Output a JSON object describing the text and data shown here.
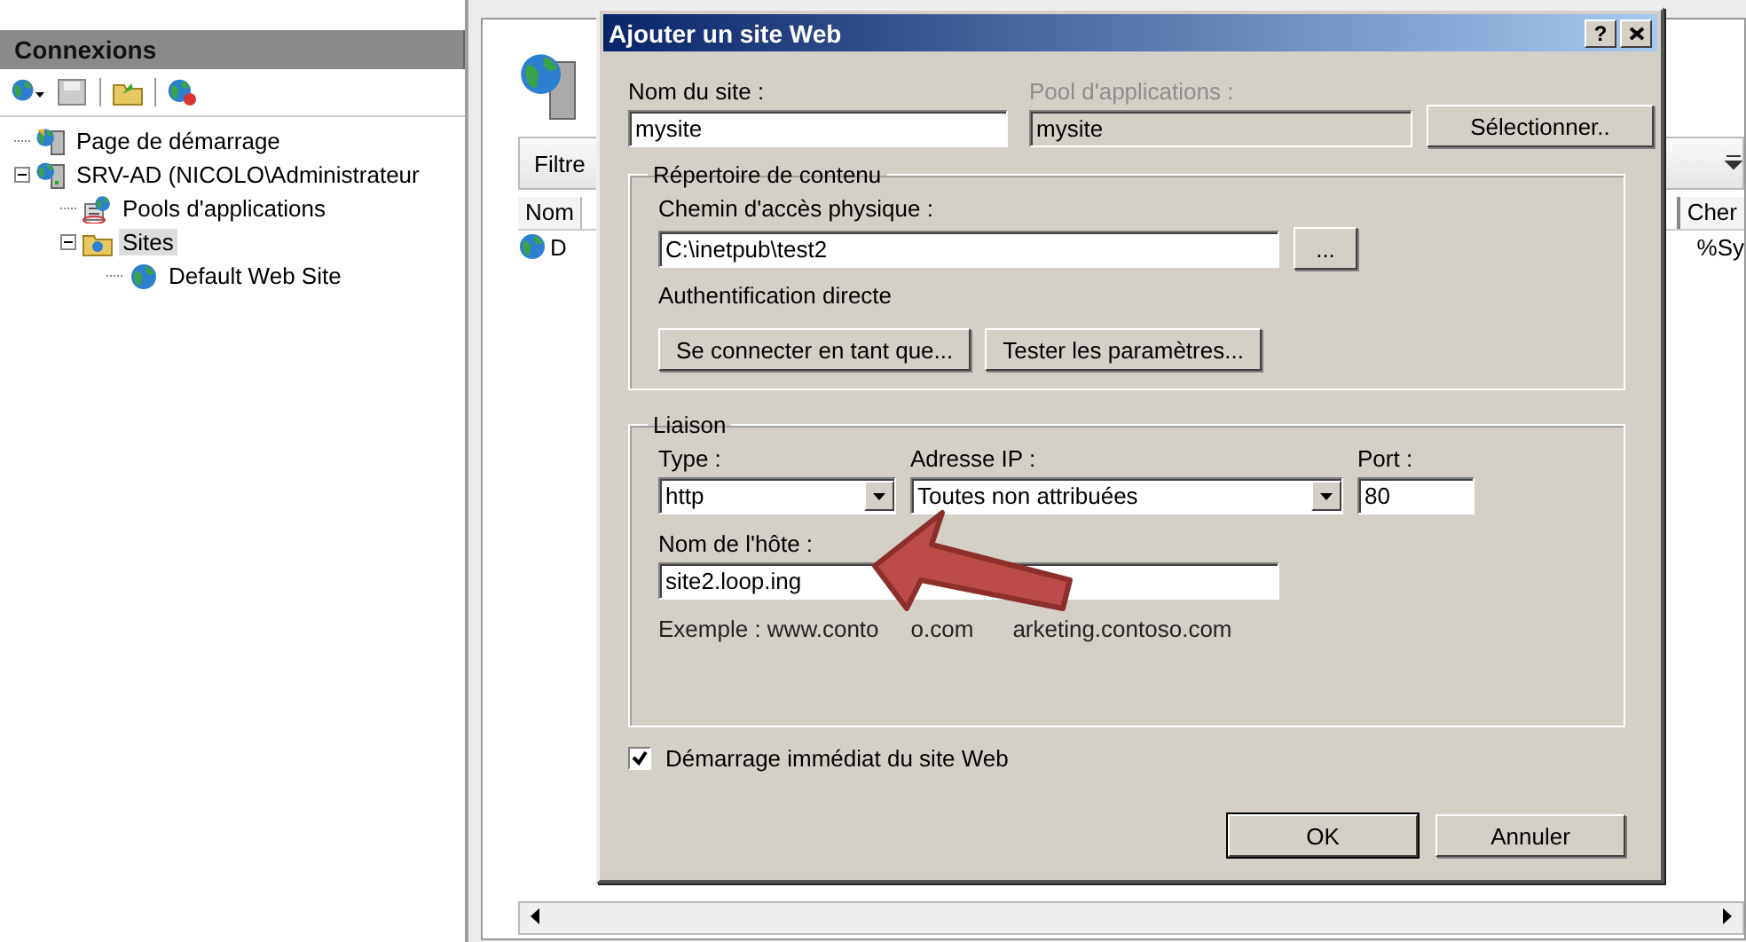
{
  "connections": {
    "title": "Connexions",
    "tree": [
      {
        "label": "Page de démarrage",
        "kind": "start",
        "selected": false
      },
      {
        "label": "SRV-AD (NICOLO\\Administrateur",
        "kind": "server",
        "selected": false,
        "expanded": true,
        "children": [
          {
            "label": "Pools d'applications",
            "kind": "pools",
            "selected": false
          },
          {
            "label": "Sites",
            "kind": "folder",
            "selected": true,
            "expanded": true,
            "children": [
              {
                "label": "Default Web Site",
                "kind": "site",
                "selected": false
              }
            ]
          }
        ]
      }
    ]
  },
  "sites_panel": {
    "toolbar_label": "Filtre",
    "columns": [
      "Nom",
      "Cher"
    ],
    "rows": [
      {
        "cells": [
          "D",
          "%Sy"
        ]
      }
    ]
  },
  "dialog": {
    "title": "Ajouter un site Web",
    "help_button": "?",
    "site_name": {
      "label": "Nom du site :",
      "value": "mysite"
    },
    "app_pool": {
      "label": "Pool d'applications :",
      "value": "mysite",
      "disabled": true
    },
    "select_button": "Sélectionner..",
    "content": {
      "title": "Répertoire de contenu",
      "path_label": "Chemin d'accès physique :",
      "path_value": "C:\\inetpub\\test2",
      "browse_button": "...",
      "auth_label": "Authentification directe",
      "buttons": [
        "Se connecter en tant que...",
        "Tester les paramètres..."
      ]
    },
    "binding": {
      "title": "Liaison",
      "type": {
        "label": "Type :",
        "value": "http"
      },
      "ip": {
        "label": "Adresse IP :",
        "value": "Toutes non attribuées"
      },
      "port": {
        "label": "Port :",
        "value": "80"
      },
      "host": {
        "label": "Nom de l'hôte :",
        "value": "site2.loop.ing"
      },
      "example": [
        "Exemple : www.conto",
        "o.com",
        "arketing.contoso.com"
      ]
    },
    "start_checkbox": {
      "label": "Démarrage immédiat du site Web",
      "checked": true
    },
    "buttons": [
      {
        "label": "OK",
        "default": true
      },
      {
        "label": "Annuler",
        "default": false
      }
    ]
  }
}
